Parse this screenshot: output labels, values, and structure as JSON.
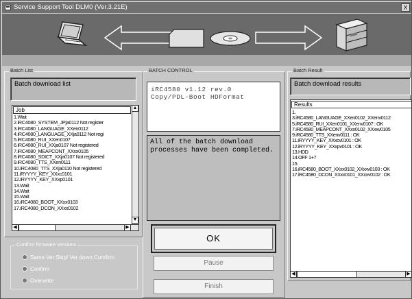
{
  "window": {
    "title": "Service Support Tool DLM0 (Ver.3.21E)",
    "close_label": "X"
  },
  "icons": {
    "laptop": "laptop-icon",
    "copier": "copier-icon",
    "card": "card-icon",
    "disc": "disc-icon"
  },
  "batch_list": {
    "group_label": "Batch List",
    "header": "Batch download list",
    "column": "Job",
    "items": [
      "1.Wait",
      "2.iRC4080_SYSTEM_JPja0112 Not register",
      "3.iRC4080_LANGUAGE_XXen0112",
      "4.iRC4080_LANGUAGE_XXja0112 Not regi",
      "5.iRC4080_RUI_XXen0107",
      "6.iRC4080_RUI_XXja0107 Not registered",
      "7.iRC4080_MEAPCONT_XXxx0105",
      "8.iRC4080_SDICT_XXja0107 Not registered",
      "9.iRC4080_TTS_XXen0111",
      "10.iRC4080_TTS_XXja0110 Not registered",
      "11.iRYYYY_KEY_XXxc0101",
      "12.iRYYYY_KEY_XXxp0101",
      "13.Wait",
      "14.Wait",
      "15.Wait",
      "16.iRC4080_BOOT_XXxx0103",
      "17.iRC4080_DCON_XXxx0102"
    ]
  },
  "firmware": {
    "group_label": "Confirm firmware versions",
    "options": [
      "Same Ver:Skip/ Ver down:Comfirm",
      "Confirm",
      "Overwrite"
    ]
  },
  "batch_control": {
    "group_label": "BATCH CONTROL",
    "device_info": "iRC4580 v1.12 rev.0\nCopy/PDL-Boot HDFormat",
    "message": "All of the batch download processes have been completed.",
    "ok_label": "OK",
    "pause_label": "Pause",
    "finish_label": "Finish"
  },
  "batch_result": {
    "group_label": "Batch Result",
    "header": "Batch download results",
    "column": "Results",
    "items": [
      "1.",
      "3.iRC4580_LANGUAGE_XXen0102_XXenv0112",
      "5.iRC4580_RUI_XXen0101_XXenv0107 : OK",
      "7.iRC4580_MEAPCONT_XXxx0102_XXxxv0105",
      "9.iRC4580_TTS_XXenv0111 : OK",
      "11.iRYYYY_KEY_XXxcv0101 : OK",
      "12.iRYYYY_KEY_XXxpv0101 : OK",
      "13.HDD",
      "14.OFF 1+7",
      "15.",
      "16.iRC4580_BOOT_XXxx0102_XXxxv0103 : OK",
      "17.iRC4580_DCON_XXxx0101_XXxxv0102 : OK"
    ]
  }
}
